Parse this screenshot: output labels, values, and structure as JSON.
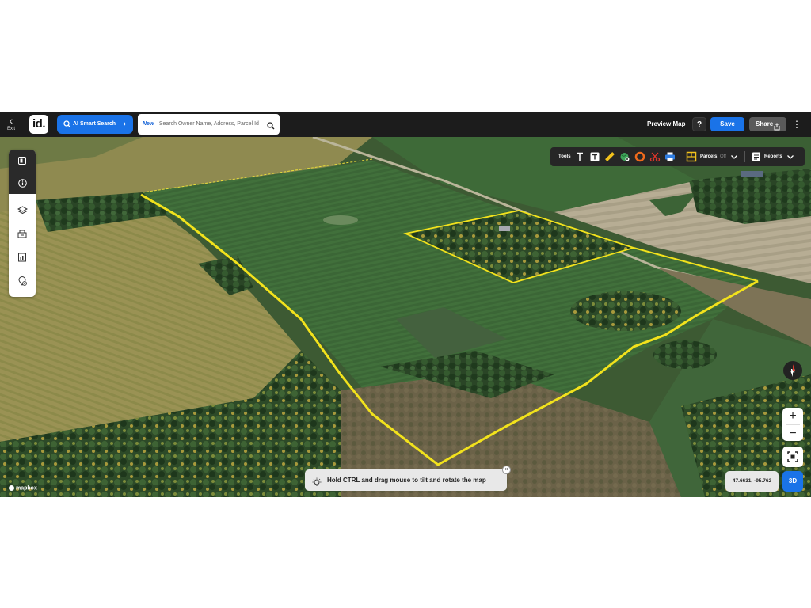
{
  "topbar": {
    "exit_label": "Exit",
    "logo_text": "id.",
    "ai_search_label": "AI Smart Search",
    "search": {
      "new_badge": "New",
      "placeholder": "Search Owner Name, Address, Parcel Id"
    },
    "preview_label": "Preview Map",
    "help_label": "?",
    "save_label": "Save",
    "share_label": "Share",
    "more_icon": "kebab-icon"
  },
  "left_panel": {
    "items": [
      {
        "name": "panel-toggle-icon"
      },
      {
        "name": "info-icon"
      },
      {
        "name": "layers-icon"
      },
      {
        "name": "buildings-icon"
      },
      {
        "name": "report-doc-icon"
      },
      {
        "name": "add-location-icon"
      }
    ]
  },
  "tools_bar": {
    "tools_label": "Tools",
    "parcels_label": "Parcels:",
    "parcels_state": "Off",
    "reports_label": "Reports",
    "icons": [
      "text-icon",
      "text-box-icon",
      "ruler-icon",
      "globe-pin-icon",
      "buffer-ring-icon",
      "scissors-icon",
      "print-icon",
      "parcels-icon",
      "reports-icon"
    ]
  },
  "map": {
    "attribution": "mapbox",
    "boundary_color": "#f2e21c",
    "hint": "Hold CTRL and drag mouse to tilt and rotate the map",
    "hint_close": "×",
    "coordinates": "47.6631, -95.762",
    "mode_3d_label": "3D",
    "compass_label": "N",
    "zoom_in": "+",
    "zoom_out": "−"
  }
}
